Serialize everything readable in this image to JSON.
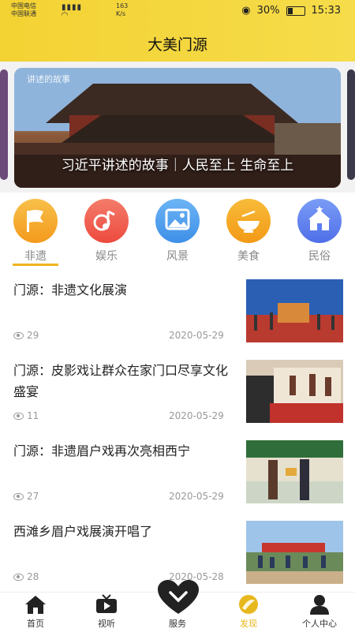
{
  "statusbar": {
    "carrier1": "中国电信",
    "carrier2": "中国联通",
    "hd": "HD",
    "speed": "163",
    "speed_unit": "K/s",
    "battery": "30%",
    "time": "15:33"
  },
  "header": {
    "title": "大美门源"
  },
  "banner": {
    "small_caption": "讲述的故事",
    "caption": "习近平讲述的故事｜人民至上 生命至上"
  },
  "categories": [
    {
      "label": "非遗",
      "icon": "flag-icon",
      "color": "#f5a623"
    },
    {
      "label": "娱乐",
      "icon": "music-icon",
      "color": "#f05c50"
    },
    {
      "label": "风景",
      "icon": "landscape-icon",
      "color": "#4a9ff0"
    },
    {
      "label": "美食",
      "icon": "food-bowl-icon",
      "color": "#f5a21f"
    },
    {
      "label": "民俗",
      "icon": "house-icon",
      "color": "#5b7ff0"
    }
  ],
  "news": [
    {
      "title": "门源：非遗文化展演",
      "views": "29",
      "date": "2020-05-29"
    },
    {
      "title": "门源：皮影戏让群众在家门口尽享文化盛宴",
      "views": "11",
      "date": "2020-05-29"
    },
    {
      "title": "门源：非遗眉户戏再次亮相西宁",
      "views": "27",
      "date": "2020-05-29"
    },
    {
      "title": "西滩乡眉户戏展演开唱了",
      "views": "28",
      "date": "2020-05-28"
    }
  ],
  "tabs": [
    {
      "label": "首页",
      "icon": "home-icon"
    },
    {
      "label": "视听",
      "icon": "tv-icon"
    },
    {
      "label": "服务",
      "icon": "heart-icon"
    },
    {
      "label": "发现",
      "icon": "discover-icon"
    },
    {
      "label": "个人中心",
      "icon": "user-icon"
    }
  ],
  "colors": {
    "accent": "#f3d233",
    "active_tab": "#e7b81e"
  }
}
